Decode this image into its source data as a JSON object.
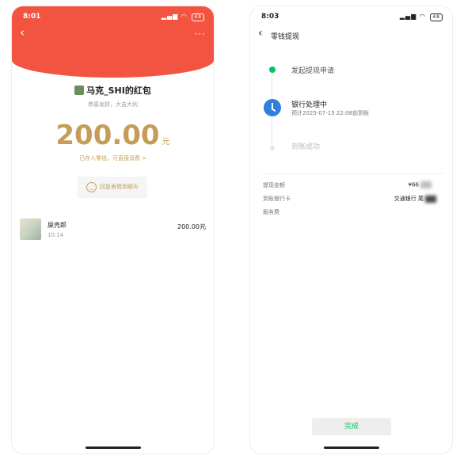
{
  "left_phone": {
    "status": {
      "time": "8:01",
      "battery": "49"
    },
    "envelope_title": "马克_SHI的红包",
    "blessing": "恭喜发财，大吉大利",
    "amount": "200.00",
    "currency_unit": "元",
    "stored_note": "已存入零钱，可直接消费 >",
    "reply_button": "回复表情到聊天",
    "record": {
      "name": "屎壳郎",
      "time": "10:14",
      "amount": "200.00元"
    }
  },
  "right_phone": {
    "status": {
      "time": "8:03",
      "battery": "48"
    },
    "title": "零钱提现",
    "steps": [
      {
        "label": "发起提现申请"
      },
      {
        "label": "银行处理中",
        "sub": "预计2025-07-15 22:08前到账"
      },
      {
        "label": "到账成功"
      }
    ],
    "details": [
      {
        "label": "提现金额",
        "value": "¥66"
      },
      {
        "label": "到账银行卡",
        "value": "交通银行 尾"
      },
      {
        "label": "服务费",
        "value": ""
      }
    ],
    "done_button": "完成"
  },
  "colors": {
    "red": "#f25441",
    "gold": "#c59d58",
    "green": "#07c160",
    "blue": "#2f7fdc"
  }
}
